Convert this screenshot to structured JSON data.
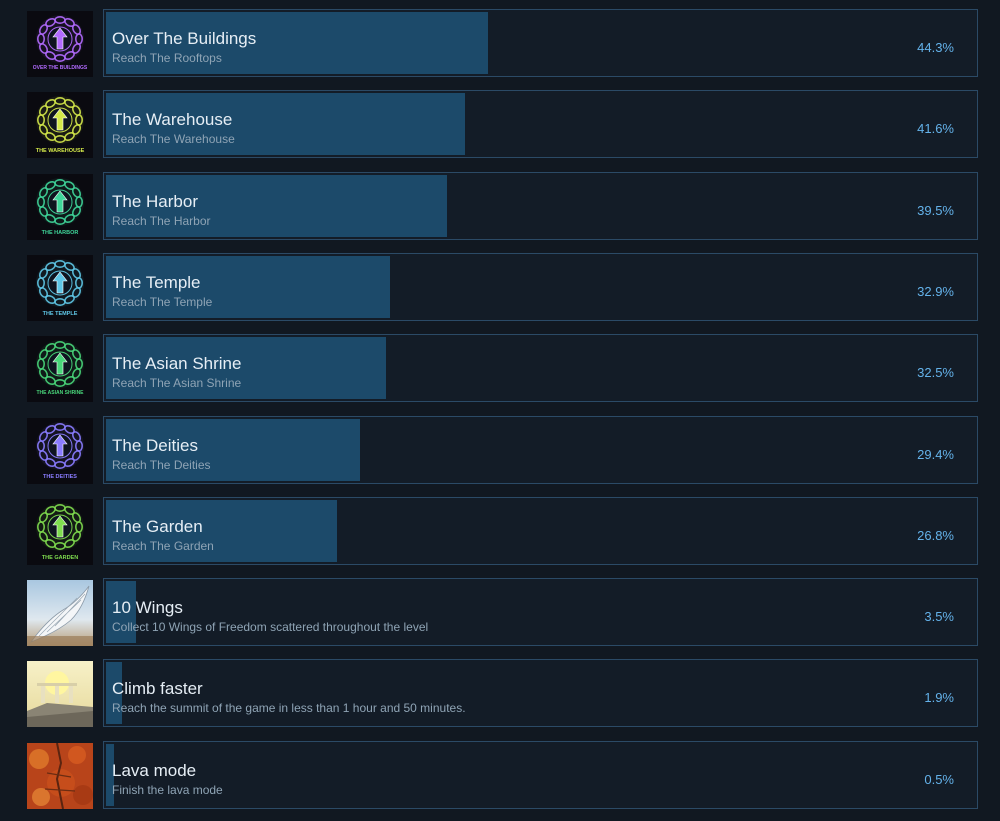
{
  "achievements": [
    {
      "title": "Over The Buildings",
      "description": "Reach The Rooftops",
      "percent_label": "44.3%",
      "percent": 44.3,
      "icon": "over-the-buildings-badge-icon",
      "icon_caption": "OVER THE BUILDINGS",
      "accent": "#b26bff"
    },
    {
      "title": "The Warehouse",
      "description": "Reach The Warehouse",
      "percent_label": "41.6%",
      "percent": 41.6,
      "icon": "the-warehouse-badge-icon",
      "icon_caption": "THE WAREHOUSE",
      "accent": "#d4e84a"
    },
    {
      "title": "The Harbor",
      "description": "Reach The Harbor",
      "percent_label": "39.5%",
      "percent": 39.5,
      "icon": "the-harbor-badge-icon",
      "icon_caption": "THE HARBOR",
      "accent": "#3fd59a"
    },
    {
      "title": "The Temple",
      "description": "Reach The Temple",
      "percent_label": "32.9%",
      "percent": 32.9,
      "icon": "the-temple-badge-icon",
      "icon_caption": "THE TEMPLE",
      "accent": "#5fc6e6"
    },
    {
      "title": "The Asian Shrine",
      "description": "Reach The Asian Shrine",
      "percent_label": "32.5%",
      "percent": 32.5,
      "icon": "the-asian-shrine-badge-icon",
      "icon_caption": "THE ASIAN SHRINE",
      "accent": "#49d67a"
    },
    {
      "title": "The Deities",
      "description": "Reach The Deities",
      "percent_label": "29.4%",
      "percent": 29.4,
      "icon": "the-deities-badge-icon",
      "icon_caption": "THE DEITIES",
      "accent": "#8a7cff"
    },
    {
      "title": "The Garden",
      "description": "Reach The Garden",
      "percent_label": "26.8%",
      "percent": 26.8,
      "icon": "the-garden-badge-icon",
      "icon_caption": "THE GARDEN",
      "accent": "#7fdc4f"
    },
    {
      "title": "10 Wings",
      "description": "Collect 10 Wings of Freedom scattered throughout the level",
      "percent_label": "3.5%",
      "percent": 3.5,
      "icon": "wing-icon",
      "icon_caption": "",
      "accent": "#c9d8e6"
    },
    {
      "title": "Climb faster",
      "description": "Reach the summit of the game in less than 1 hour and 50 minutes.",
      "percent_label": "1.9%",
      "percent": 1.9,
      "icon": "summit-sun-icon",
      "icon_caption": "",
      "accent": "#f2d85a"
    },
    {
      "title": "Lava mode",
      "description": "Finish the lava mode",
      "percent_label": "0.5%",
      "percent": 0.5,
      "icon": "lava-icon",
      "icon_caption": "",
      "accent": "#d9531e"
    }
  ]
}
